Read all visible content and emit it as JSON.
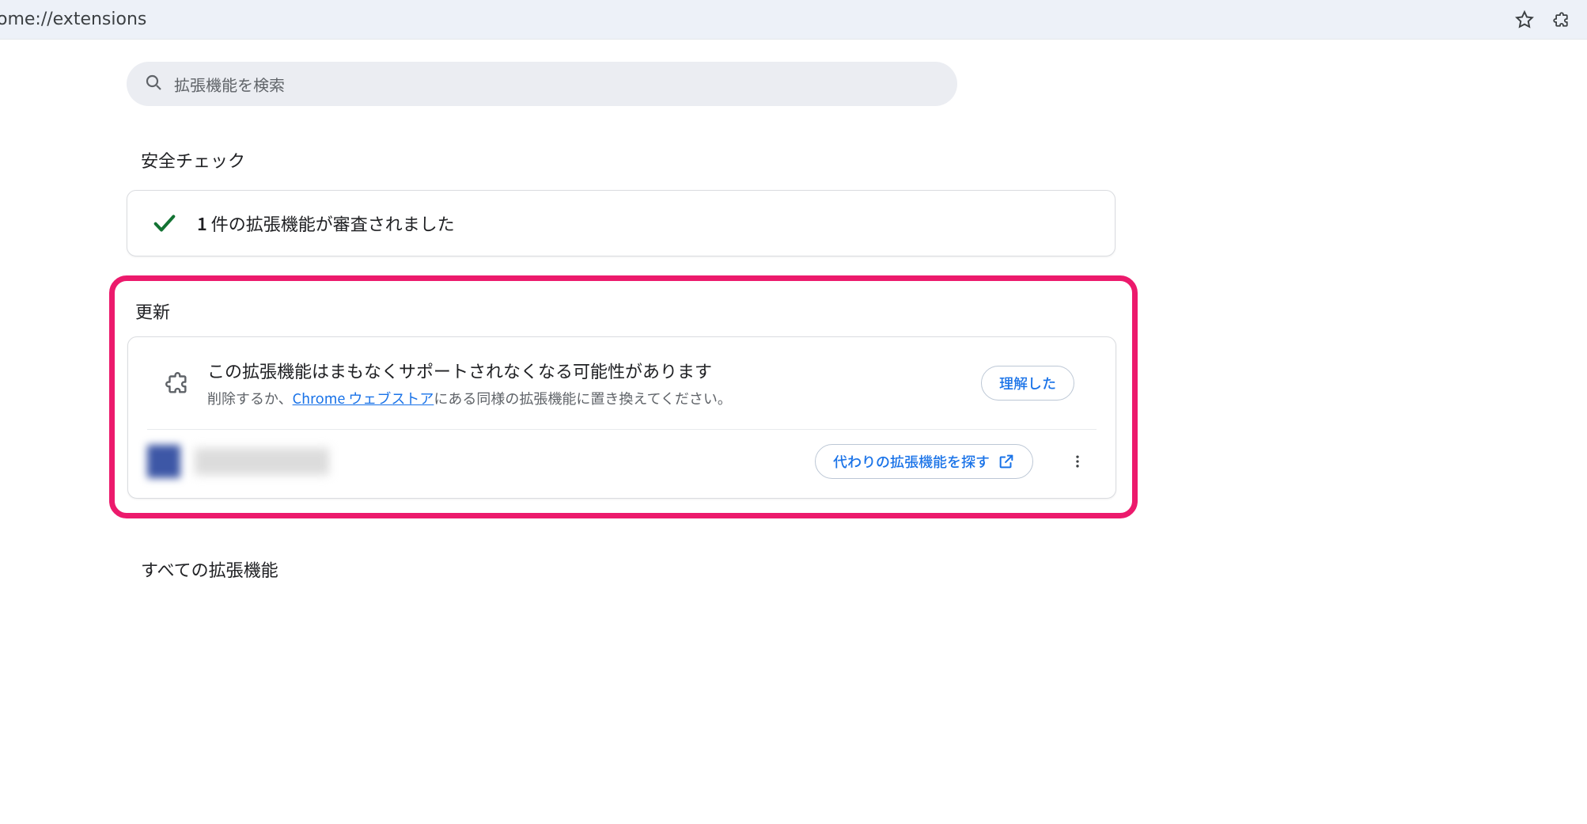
{
  "address_bar": {
    "url": "ome://extensions"
  },
  "search": {
    "placeholder": "拡張機能を検索"
  },
  "sections": {
    "safety_check_title": "安全チェック",
    "updates_title": "更新",
    "all_extensions_title": "すべての拡張機能"
  },
  "safety_check": {
    "count": "1",
    "text_suffix": " 件の拡張機能が審査されました"
  },
  "updates": {
    "banner_title": "この拡張機能はまもなくサポートされなくなる可能性があります",
    "banner_desc_prefix": "削除するか、",
    "banner_desc_link": "Chrome ウェブストア",
    "banner_desc_suffix": "にある同様の拡張機能に置き換えてください。",
    "acknowledge_button": "理解した",
    "find_alternative_button": "代わりの拡張機能を探す"
  },
  "extensions_list": [
    {
      "name": "(redacted)"
    }
  ]
}
